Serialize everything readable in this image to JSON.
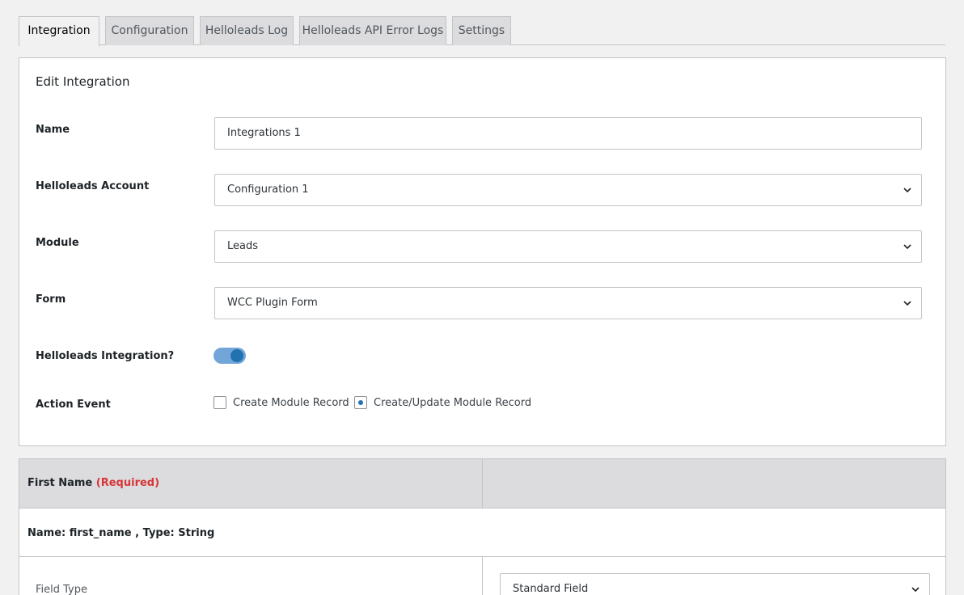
{
  "tabs": [
    {
      "label": "Integration",
      "active": true
    },
    {
      "label": "Configuration",
      "active": false
    },
    {
      "label": "Helloleads Log",
      "active": false
    },
    {
      "label": "Helloleads API Error Logs",
      "active": false
    },
    {
      "label": "Settings",
      "active": false
    }
  ],
  "card": {
    "title": "Edit Integration",
    "name_label": "Name",
    "name_value": "Integrations 1",
    "account_label": "Helloleads Account",
    "account_value": "Configuration 1",
    "module_label": "Module",
    "module_value": "Leads",
    "form_label": "Form",
    "form_value": "WCC Plugin Form",
    "integration_label": "Helloleads Integration?",
    "integration_enabled": true,
    "action_label": "Action Event",
    "action_options": [
      {
        "label": "Create Module Record",
        "selected": false
      },
      {
        "label": "Create/Update Module Record",
        "selected": true
      }
    ]
  },
  "mapping": {
    "field_title": "First Name",
    "required_text": "(Required)",
    "field_info": "Name: first_name , Type: String",
    "field_type_label": "Field Type",
    "field_type_value": "Standard Field"
  },
  "colors": {
    "accent": "#2271b1",
    "required": "#d63638",
    "toggle_track": "#72a5d8"
  }
}
